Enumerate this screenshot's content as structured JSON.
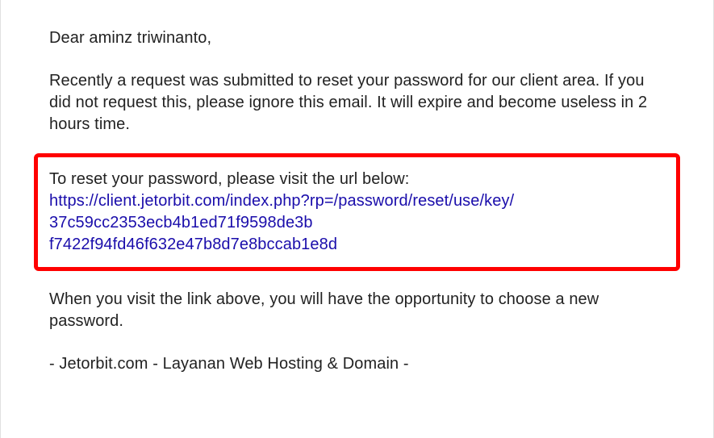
{
  "email": {
    "greeting": "Dear aminz triwinanto,",
    "intro": "Recently a request was submitted to reset your password for our client area. If you did not request this, please ignore this email. It will expire and become useless in 2 hours time.",
    "reset_instruction": "To reset your password, please visit the url below:",
    "reset_url_line1": "https://client.jetorbit.com/index.php?rp=/password/reset/use/key/",
    "reset_url_line2": "37c59cc2353ecb4b1ed71f9598de3b",
    "reset_url_line3": "f7422f94fd46f632e47b8d7e8bccab1e8d",
    "followup": "When you visit the link above, you will have the opportunity to choose a new password.",
    "signature": "- Jetorbit.com - Layanan Web Hosting & Domain -"
  }
}
